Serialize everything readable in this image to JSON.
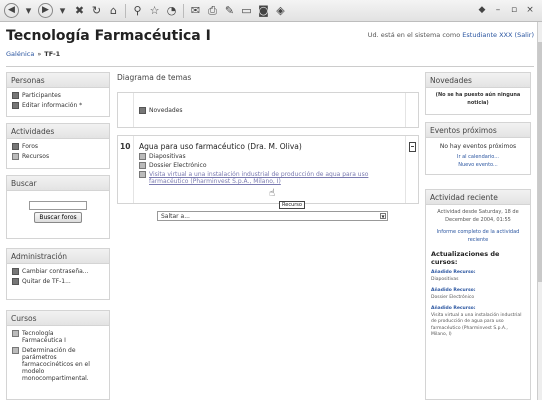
{
  "header": {
    "title": "Tecnología Farmacéutica I",
    "login_prefix": "Ud. está en el sistema como ",
    "login_user": "Estudiante XXX",
    "login_logout": "(Salir)",
    "breadcrumb": [
      "Galénica",
      "»",
      "TF-1"
    ]
  },
  "left": {
    "personas": {
      "title": "Personas",
      "items": [
        "Participantes",
        "Editar información *"
      ]
    },
    "actividades": {
      "title": "Actividades",
      "items": [
        "Foros",
        "Recursos"
      ]
    },
    "buscar": {
      "title": "Buscar",
      "button": "Buscar foros"
    },
    "admin": {
      "title": "Administración",
      "items": [
        "Cambiar contraseña...",
        "Quitar de TF-1..."
      ]
    },
    "cursos": {
      "title": "Cursos",
      "items": [
        "Tecnología Farmacéutica I",
        "Determinación de parámetros farmacocinéticos en el modelo monocompartimental."
      ]
    }
  },
  "center": {
    "title": "Diagrama de temas",
    "top_item": "Novedades",
    "section_number": "10",
    "section_title": "Agua para uso farmacéutico (Dra. M. Oliva)",
    "items": [
      "Diapositivas",
      "Dossier Electrónico"
    ],
    "link": "Visita virtual a una instalación industrial de producción de agua para uso farmacéutico (Pharminvest S.p.A., Milano, I)",
    "tooltip": "Recurso",
    "jump": "Saltar a..."
  },
  "right": {
    "novedades": {
      "title": "Novedades",
      "text": "(No se ha puesto aún ninguna noticia)"
    },
    "eventos": {
      "title": "Eventos próximos",
      "none": "No hay eventos próximos",
      "links": [
        "Ir al calendario...",
        "Nuevo evento..."
      ]
    },
    "actividad": {
      "title": "Actividad reciente",
      "since": "Actividad desde Saturday, 18 de December de 2004, 01:55",
      "report": "Informe completo de la actividad reciente",
      "updates_label": "Actualizaciones de cursos:",
      "entries": [
        {
          "head": "Añadido Recurso:",
          "text": "Diapositivas"
        },
        {
          "head": "Añadido Recurso:",
          "text": "Dossier Electrónico"
        },
        {
          "head": "Añadido Recurso:",
          "text": "Visita virtual a una instalación industrial de producción de agua para uso farmacéutico (Pharminvest S.p.A., Milano, I)"
        }
      ]
    }
  }
}
